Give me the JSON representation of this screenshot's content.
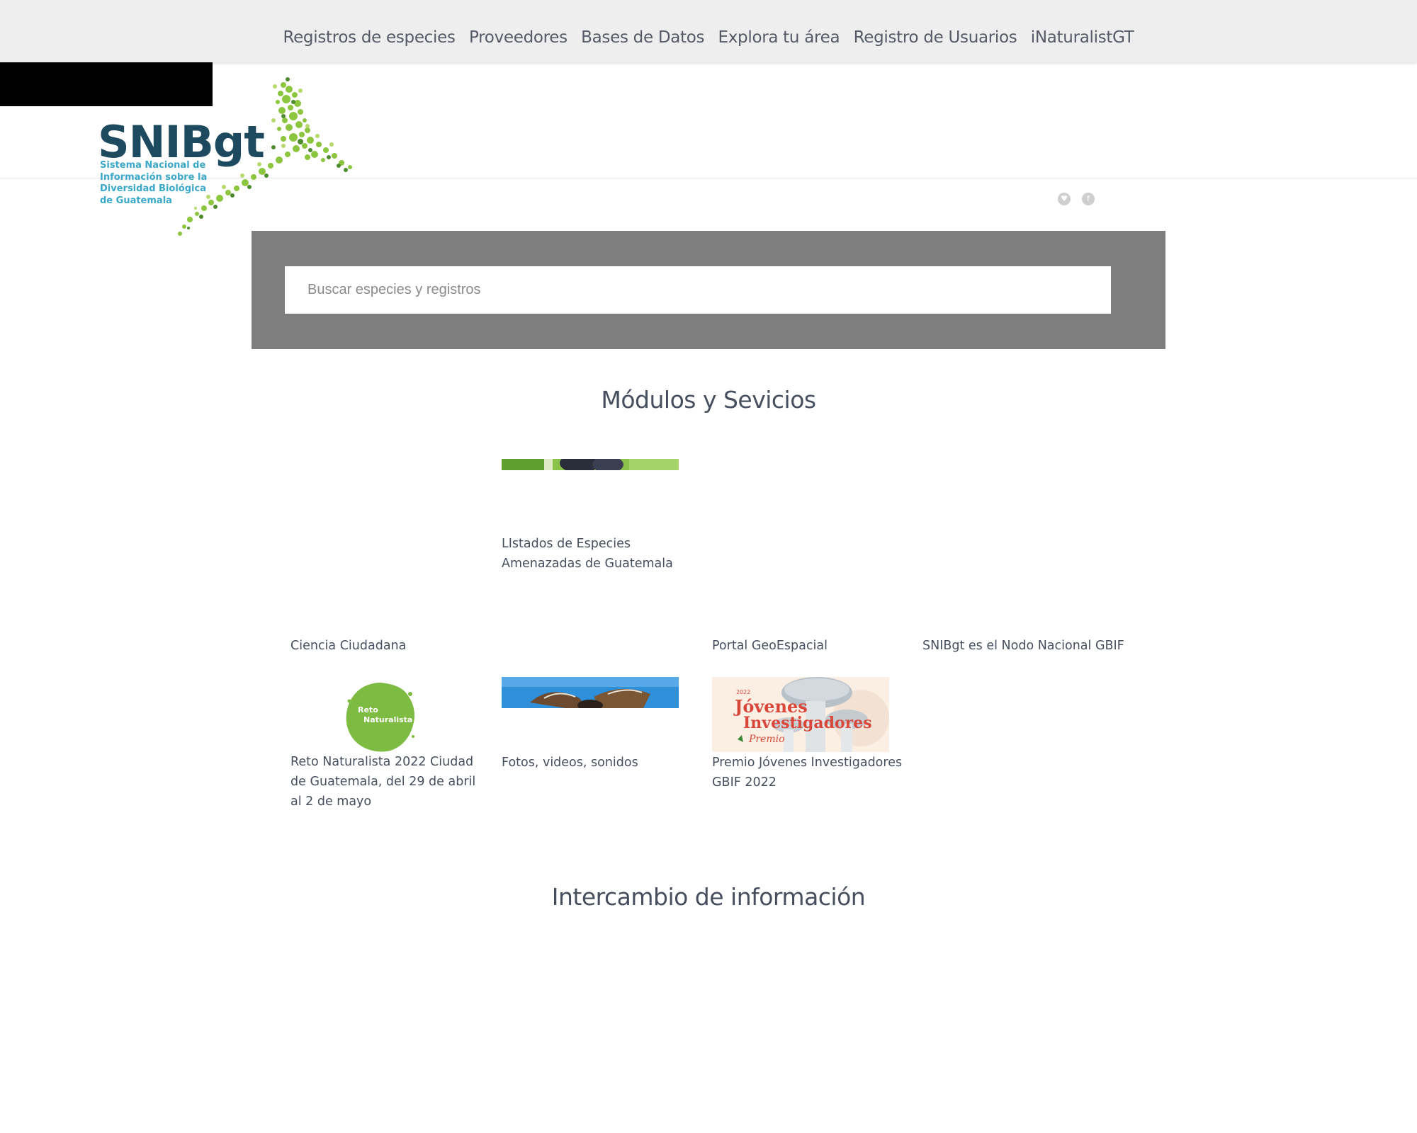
{
  "nav": {
    "items": [
      "Registros de especies",
      "Proveedores",
      "Bases de Datos",
      "Explora tu área",
      "Registro de Usuarios",
      "iNaturalistGT"
    ]
  },
  "logo": {
    "name": "SNIBgt",
    "subtitle_lines": [
      "Sistema Nacional de",
      "Información sobre la",
      "Diversidad Biológica",
      "de Guatemala"
    ],
    "colors": {
      "wordmark": "#1e4a60",
      "subtitle": "#3aa8c8",
      "dots": [
        "#8cc63f",
        "#4e8a2e",
        "#b7d86b",
        "#2f6b3a"
      ]
    }
  },
  "social": {
    "twitter_icon": "twitter-icon",
    "facebook_icon": "facebook-icon",
    "twitter_glyph": "♥",
    "facebook_glyph": "f"
  },
  "search": {
    "placeholder": "Buscar especies y registros"
  },
  "sections": {
    "modules_title": "Módulos y Sevicios",
    "exchange_title": "Intercambio de información"
  },
  "tiles": {
    "threatened": "LIstados de Especies Amenazadas de Guatemala",
    "citizen_science": "Ciencia Ciudadana",
    "geo_portal": "Portal GeoEspacial",
    "gbif_node": "SNIBgt es el Nodo Nacional GBIF",
    "reto": "Reto Naturalista 2022 Ciudad de Guatemala, del 29 de abril al 2 de mayo",
    "media": "Fotos, videos, sonidos",
    "premio": "Premio Jóvenes Investigadores GBIF 2022"
  },
  "reto_badge": {
    "line1": "Reto",
    "line2": "Naturalista",
    "color": "#7dbb42"
  },
  "premio_banner": {
    "year": "2022",
    "line1": "Jóvenes",
    "line2": "Investigadores",
    "line3": "Premio",
    "color": "#d9473a"
  }
}
